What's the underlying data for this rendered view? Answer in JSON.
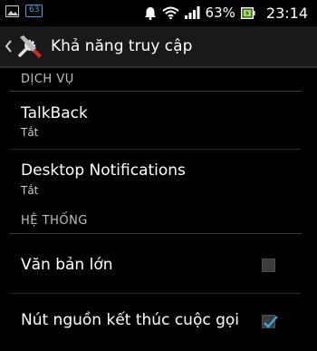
{
  "status_bar": {
    "notification_badge": "63",
    "battery_percent": "63%",
    "time": "23:14"
  },
  "action_bar": {
    "title": "Khả năng truy cập"
  },
  "sections": {
    "services_header": "DỊCH VỤ",
    "system_header": "HỆ THỐNG"
  },
  "items": {
    "talkback": {
      "title": "TalkBack",
      "summary": "Tắt"
    },
    "desktop_notifications": {
      "title": "Desktop Notifications",
      "summary": "Tắt"
    },
    "large_text": {
      "title": "Văn bản lớn",
      "checked": false
    },
    "power_ends_call": {
      "title": "Nút nguồn kết thúc cuộc gọi",
      "checked": true
    }
  },
  "colors": {
    "accent": "#32aee6",
    "action_bar_bg": "#191919",
    "background": "#000000"
  }
}
